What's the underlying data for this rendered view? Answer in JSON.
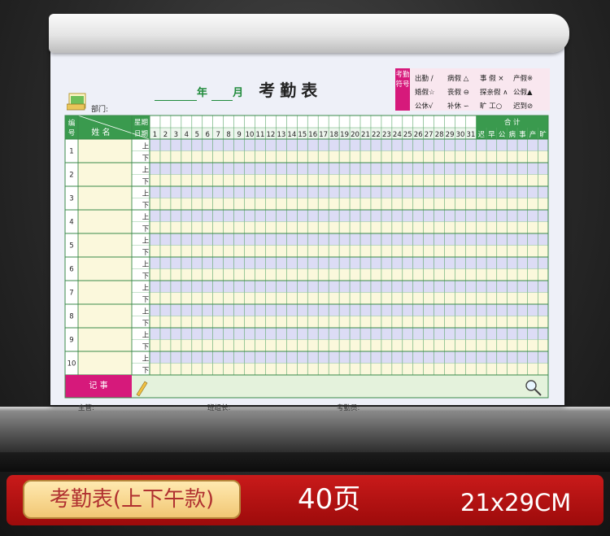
{
  "header": {
    "year_label": "年",
    "month_label": "月",
    "title": "考勤表",
    "dept_label": "部门:"
  },
  "legend": {
    "side_label": "考勤符号",
    "items": [
      [
        "出勤 /",
        "病假 △",
        "事 假 ×",
        "产假※"
      ],
      [
        "婚假☆",
        "丧假 ⊖",
        "探亲假 ∧",
        "公假▲"
      ],
      [
        "公休√",
        "补休 ∽",
        "旷 工○",
        "迟到⊘"
      ]
    ]
  },
  "table": {
    "col_num": "编号",
    "col_name": "姓 名",
    "col_week": "星期",
    "col_date": "日期",
    "days": [
      "1",
      "2",
      "3",
      "4",
      "5",
      "6",
      "7",
      "8",
      "9",
      "10",
      "11",
      "12",
      "13",
      "14",
      "15",
      "16",
      "17",
      "18",
      "19",
      "20",
      "21",
      "22",
      "23",
      "24",
      "25",
      "26",
      "27",
      "28",
      "29",
      "30",
      "31"
    ],
    "total_label": "合 计",
    "total_cols": [
      "迟",
      "早",
      "公",
      "病",
      "事",
      "产",
      "旷"
    ],
    "row_numbers": [
      "1",
      "2",
      "3",
      "4",
      "5",
      "6",
      "7",
      "8",
      "9",
      "10"
    ],
    "am": "上",
    "pm": "下",
    "notes_label": "记 事"
  },
  "footer": {
    "supervisor": "主管:",
    "team_leader": "班组长:",
    "clerk": "考勤员:"
  },
  "banner": {
    "product": "考勤表(上下午款)",
    "pages": "40页",
    "size": "21x29CM"
  },
  "colors": {
    "green": "#3a9a4e",
    "magenta": "#d6197b",
    "row_lavender": "#dcdcf5",
    "row_cream": "#fbf8dc",
    "banner_red": "#b31212"
  }
}
